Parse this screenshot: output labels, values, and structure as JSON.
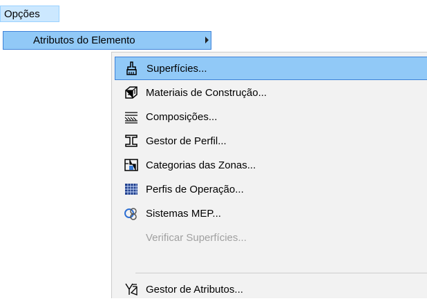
{
  "menubar": {
    "options_label": "Opções"
  },
  "submenu_level1": {
    "label": "Atributos do Elemento"
  },
  "submenu_level2": {
    "items": [
      {
        "label": "Superfícies...",
        "icon": "paint-brush-icon",
        "state": "highlighted"
      },
      {
        "label": "Materiais de Construção...",
        "icon": "building-material-icon",
        "state": "enabled"
      },
      {
        "label": "Composições...",
        "icon": "composite-layers-icon",
        "state": "enabled"
      },
      {
        "label": "Gestor de Perfil...",
        "icon": "profile-beam-icon",
        "state": "enabled"
      },
      {
        "label": "Categorias das Zonas...",
        "icon": "zone-category-icon",
        "state": "enabled"
      },
      {
        "label": "Perfis de Operação...",
        "icon": "operation-grid-icon",
        "state": "enabled"
      },
      {
        "label": "Sistemas MEP...",
        "icon": "mep-systems-icon",
        "state": "enabled"
      },
      {
        "label": "Verificar Superfícies...",
        "icon": "",
        "state": "disabled"
      },
      {
        "label": "Gestor de Atributos...",
        "icon": "attribute-manager-icon",
        "state": "enabled"
      }
    ]
  },
  "colors": {
    "highlight_bg": "#91c9f7",
    "highlight_border": "#3c81d8",
    "menu_bg": "#f2f2f2",
    "disabled_text": "#a0a0a0"
  }
}
